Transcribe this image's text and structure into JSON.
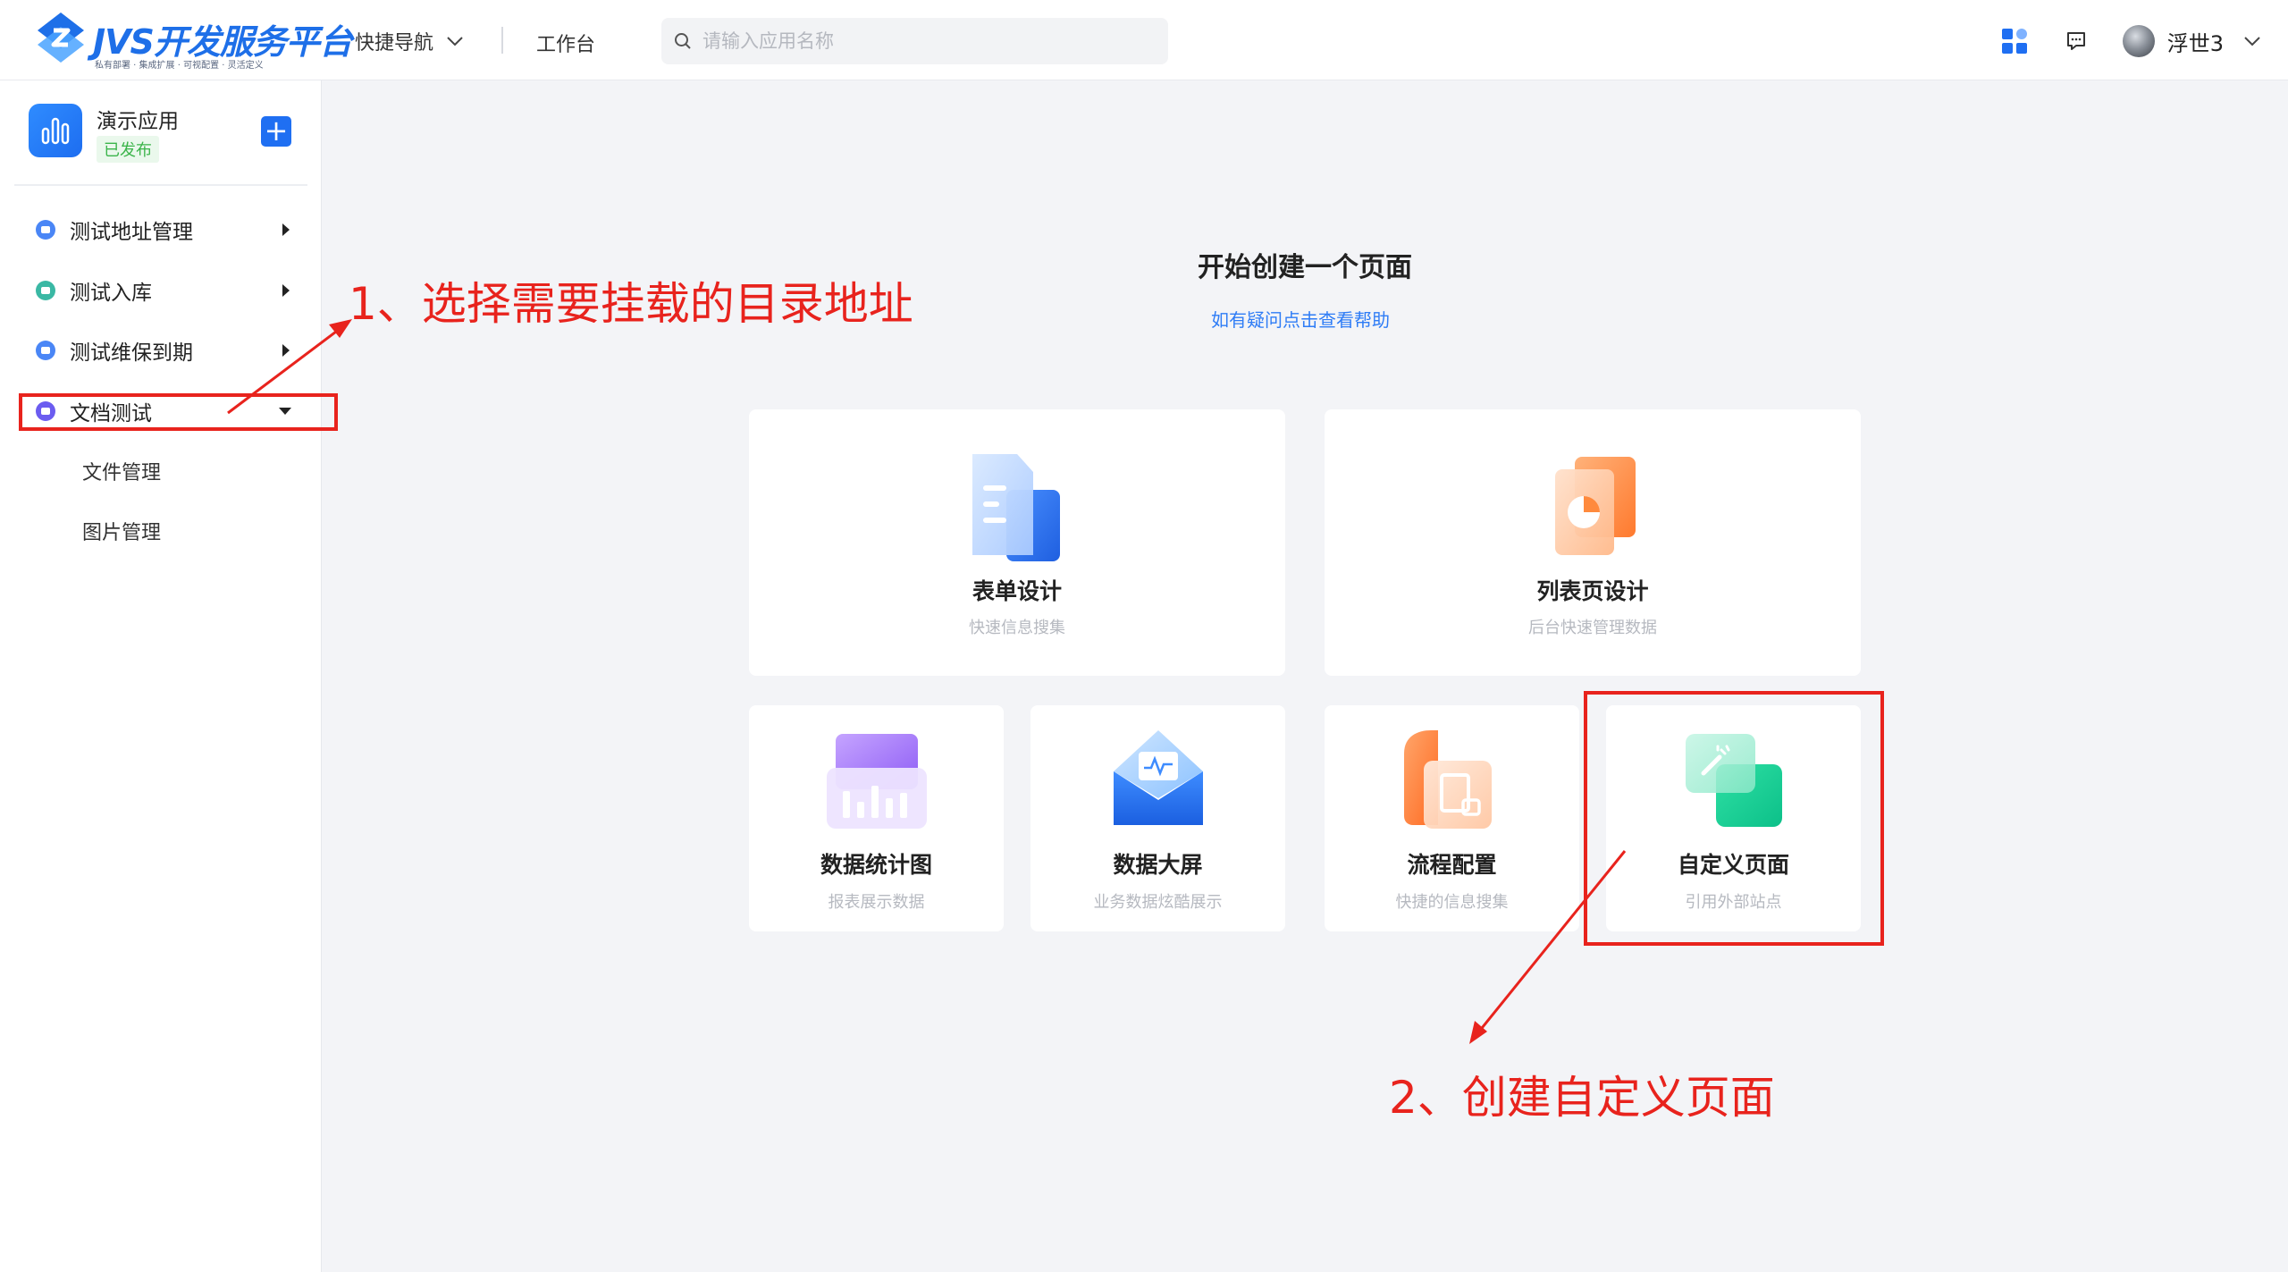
{
  "header": {
    "logo_title": "JVS开发服务平台",
    "logo_subtitle": "私有部署 · 集成扩展 · 可视配置 · 灵活定义",
    "quick_nav_label": "快捷导航",
    "workbench_label": "工作台",
    "search_placeholder": "请输入应用名称",
    "username": "浮世3",
    "icons": [
      "grid-apps-icon",
      "message-icon",
      "chevron-down-icon",
      "search-icon"
    ]
  },
  "sidebar": {
    "app_name": "演示应用",
    "app_status": "已发布",
    "add_label": "+",
    "items": [
      {
        "label": "测试地址管理",
        "icon_color": "#4a86f6",
        "expanded": false
      },
      {
        "label": "测试入库",
        "icon_color": "#3ab8a4",
        "expanded": false
      },
      {
        "label": "测试维保到期",
        "icon_color": "#4a86f6",
        "expanded": false
      },
      {
        "label": "文档测试",
        "icon_color": "#6b5cf0",
        "expanded": true
      }
    ],
    "sub_items": [
      "文件管理",
      "图片管理"
    ]
  },
  "main": {
    "title": "开始创建一个页面",
    "help_link": "如有疑问点击查看帮助",
    "cards": [
      {
        "title": "表单设计",
        "desc": "快速信息搜集",
        "icon": "form-design-icon"
      },
      {
        "title": "列表页设计",
        "desc": "后台快速管理数据",
        "icon": "list-page-icon"
      },
      {
        "title": "数据统计图",
        "desc": "报表展示数据",
        "icon": "chart-stats-icon"
      },
      {
        "title": "数据大屏",
        "desc": "业务数据炫酷展示",
        "icon": "data-screen-icon"
      },
      {
        "title": "流程配置",
        "desc": "快捷的信息搜集",
        "icon": "workflow-icon"
      },
      {
        "title": "自定义页面",
        "desc": "引用外部站点",
        "icon": "custom-page-icon"
      }
    ]
  },
  "annotations": {
    "step1": "1、选择需要挂载的目录地址",
    "step2": "2、创建自定义页面",
    "color": "#e8231d"
  }
}
